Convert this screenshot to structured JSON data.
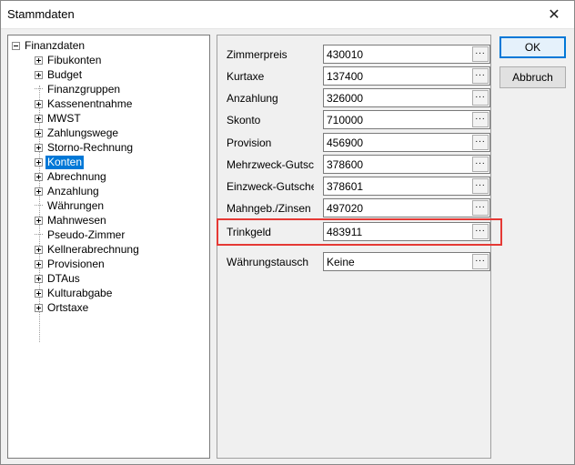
{
  "window": {
    "title": "Stammdaten",
    "close": "✕"
  },
  "tree": {
    "root": "Finanzdaten",
    "items": [
      {
        "label": "Fibukonten",
        "expandable": true
      },
      {
        "label": "Budget",
        "expandable": true
      },
      {
        "label": "Finanzgruppen",
        "expandable": false
      },
      {
        "label": "Kassenentnahme",
        "expandable": true
      },
      {
        "label": "MWST",
        "expandable": true
      },
      {
        "label": "Zahlungswege",
        "expandable": true
      },
      {
        "label": "Storno-Rechnung",
        "expandable": true
      },
      {
        "label": "Konten",
        "expandable": true,
        "selected": true
      },
      {
        "label": "Abrechnung",
        "expandable": true
      },
      {
        "label": "Anzahlung",
        "expandable": true
      },
      {
        "label": "Währungen",
        "expandable": false
      },
      {
        "label": "Mahnwesen",
        "expandable": true
      },
      {
        "label": "Pseudo-Zimmer",
        "expandable": false
      },
      {
        "label": "Kellnerabrechnung",
        "expandable": true
      },
      {
        "label": "Provisionen",
        "expandable": true
      },
      {
        "label": "DTAus",
        "expandable": true
      },
      {
        "label": "Kulturabgabe",
        "expandable": true
      },
      {
        "label": "Ortstaxe",
        "expandable": true
      }
    ]
  },
  "fields": [
    {
      "label": "Zimmerpreis",
      "value": "430010"
    },
    {
      "label": "Kurtaxe",
      "value": "137400"
    },
    {
      "label": "Anzahlung",
      "value": "326000"
    },
    {
      "label": "Skonto",
      "value": "710000"
    },
    {
      "label": "Provision",
      "value": "456900"
    },
    {
      "label": "Mehrzweck-Gutschein",
      "value": "378600"
    },
    {
      "label": "Einzweck-Gutschein",
      "value": "378601"
    },
    {
      "label": "Mahngeb./Zinsen",
      "value": "497020"
    },
    {
      "label": "Trinkgeld",
      "value": "483911"
    },
    {
      "label": "Währungstausch",
      "value": "Keine"
    }
  ],
  "browse_label": "...",
  "buttons": {
    "ok": "OK",
    "cancel": "Abbruch"
  },
  "colors": {
    "selection": "#0078d7",
    "highlight_box": "#e53935"
  }
}
